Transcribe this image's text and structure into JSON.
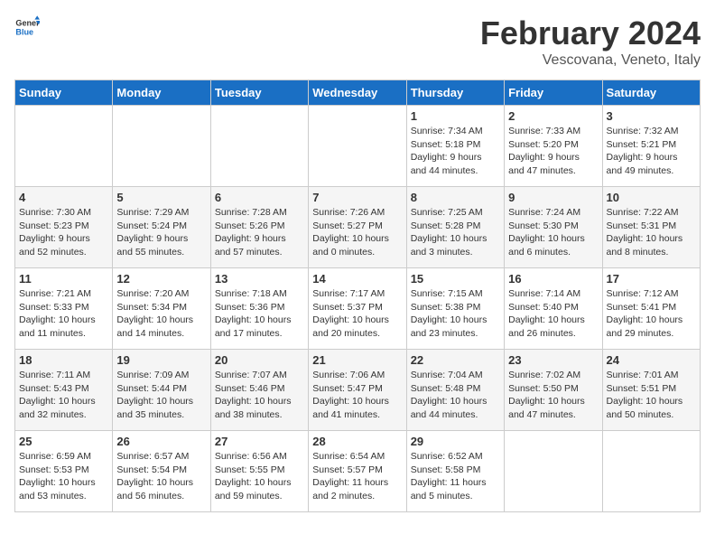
{
  "header": {
    "logo_general": "General",
    "logo_blue": "Blue",
    "title": "February 2024",
    "subtitle": "Vescovana, Veneto, Italy"
  },
  "weekdays": [
    "Sunday",
    "Monday",
    "Tuesday",
    "Wednesday",
    "Thursday",
    "Friday",
    "Saturday"
  ],
  "weeks": [
    [
      {
        "day": "",
        "info": ""
      },
      {
        "day": "",
        "info": ""
      },
      {
        "day": "",
        "info": ""
      },
      {
        "day": "",
        "info": ""
      },
      {
        "day": "1",
        "info": "Sunrise: 7:34 AM\nSunset: 5:18 PM\nDaylight: 9 hours\nand 44 minutes."
      },
      {
        "day": "2",
        "info": "Sunrise: 7:33 AM\nSunset: 5:20 PM\nDaylight: 9 hours\nand 47 minutes."
      },
      {
        "day": "3",
        "info": "Sunrise: 7:32 AM\nSunset: 5:21 PM\nDaylight: 9 hours\nand 49 minutes."
      }
    ],
    [
      {
        "day": "4",
        "info": "Sunrise: 7:30 AM\nSunset: 5:23 PM\nDaylight: 9 hours\nand 52 minutes."
      },
      {
        "day": "5",
        "info": "Sunrise: 7:29 AM\nSunset: 5:24 PM\nDaylight: 9 hours\nand 55 minutes."
      },
      {
        "day": "6",
        "info": "Sunrise: 7:28 AM\nSunset: 5:26 PM\nDaylight: 9 hours\nand 57 minutes."
      },
      {
        "day": "7",
        "info": "Sunrise: 7:26 AM\nSunset: 5:27 PM\nDaylight: 10 hours\nand 0 minutes."
      },
      {
        "day": "8",
        "info": "Sunrise: 7:25 AM\nSunset: 5:28 PM\nDaylight: 10 hours\nand 3 minutes."
      },
      {
        "day": "9",
        "info": "Sunrise: 7:24 AM\nSunset: 5:30 PM\nDaylight: 10 hours\nand 6 minutes."
      },
      {
        "day": "10",
        "info": "Sunrise: 7:22 AM\nSunset: 5:31 PM\nDaylight: 10 hours\nand 8 minutes."
      }
    ],
    [
      {
        "day": "11",
        "info": "Sunrise: 7:21 AM\nSunset: 5:33 PM\nDaylight: 10 hours\nand 11 minutes."
      },
      {
        "day": "12",
        "info": "Sunrise: 7:20 AM\nSunset: 5:34 PM\nDaylight: 10 hours\nand 14 minutes."
      },
      {
        "day": "13",
        "info": "Sunrise: 7:18 AM\nSunset: 5:36 PM\nDaylight: 10 hours\nand 17 minutes."
      },
      {
        "day": "14",
        "info": "Sunrise: 7:17 AM\nSunset: 5:37 PM\nDaylight: 10 hours\nand 20 minutes."
      },
      {
        "day": "15",
        "info": "Sunrise: 7:15 AM\nSunset: 5:38 PM\nDaylight: 10 hours\nand 23 minutes."
      },
      {
        "day": "16",
        "info": "Sunrise: 7:14 AM\nSunset: 5:40 PM\nDaylight: 10 hours\nand 26 minutes."
      },
      {
        "day": "17",
        "info": "Sunrise: 7:12 AM\nSunset: 5:41 PM\nDaylight: 10 hours\nand 29 minutes."
      }
    ],
    [
      {
        "day": "18",
        "info": "Sunrise: 7:11 AM\nSunset: 5:43 PM\nDaylight: 10 hours\nand 32 minutes."
      },
      {
        "day": "19",
        "info": "Sunrise: 7:09 AM\nSunset: 5:44 PM\nDaylight: 10 hours\nand 35 minutes."
      },
      {
        "day": "20",
        "info": "Sunrise: 7:07 AM\nSunset: 5:46 PM\nDaylight: 10 hours\nand 38 minutes."
      },
      {
        "day": "21",
        "info": "Sunrise: 7:06 AM\nSunset: 5:47 PM\nDaylight: 10 hours\nand 41 minutes."
      },
      {
        "day": "22",
        "info": "Sunrise: 7:04 AM\nSunset: 5:48 PM\nDaylight: 10 hours\nand 44 minutes."
      },
      {
        "day": "23",
        "info": "Sunrise: 7:02 AM\nSunset: 5:50 PM\nDaylight: 10 hours\nand 47 minutes."
      },
      {
        "day": "24",
        "info": "Sunrise: 7:01 AM\nSunset: 5:51 PM\nDaylight: 10 hours\nand 50 minutes."
      }
    ],
    [
      {
        "day": "25",
        "info": "Sunrise: 6:59 AM\nSunset: 5:53 PM\nDaylight: 10 hours\nand 53 minutes."
      },
      {
        "day": "26",
        "info": "Sunrise: 6:57 AM\nSunset: 5:54 PM\nDaylight: 10 hours\nand 56 minutes."
      },
      {
        "day": "27",
        "info": "Sunrise: 6:56 AM\nSunset: 5:55 PM\nDaylight: 10 hours\nand 59 minutes."
      },
      {
        "day": "28",
        "info": "Sunrise: 6:54 AM\nSunset: 5:57 PM\nDaylight: 11 hours\nand 2 minutes."
      },
      {
        "day": "29",
        "info": "Sunrise: 6:52 AM\nSunset: 5:58 PM\nDaylight: 11 hours\nand 5 minutes."
      },
      {
        "day": "",
        "info": ""
      },
      {
        "day": "",
        "info": ""
      }
    ]
  ]
}
